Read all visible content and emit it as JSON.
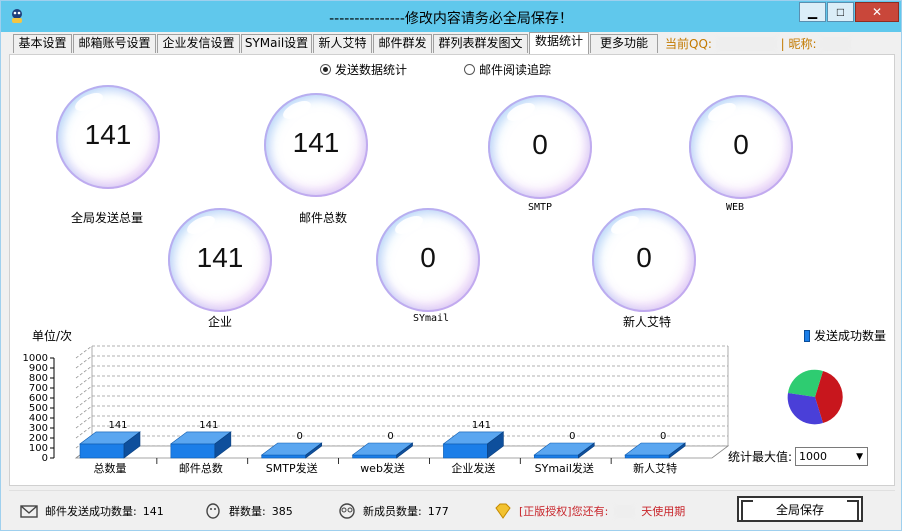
{
  "window": {
    "title": "---------------修改内容请务必全局保存！",
    "min_glyph": "▁",
    "max_glyph": "□",
    "close_glyph": "✕"
  },
  "tabs": [
    {
      "label": "基本设置"
    },
    {
      "label": "邮箱账号设置"
    },
    {
      "label": "企业发信设置"
    },
    {
      "label": "SYMail设置"
    },
    {
      "label": "新人艾特"
    },
    {
      "label": "邮件群发"
    },
    {
      "label": "群列表群发图文"
    },
    {
      "label": "数据统计",
      "active": true
    },
    {
      "label": "更多功能>>"
    }
  ],
  "account": {
    "qq_label": "当前QQ:",
    "nick_label": "| 昵称:"
  },
  "mode": {
    "option1": "发送数据统计",
    "option2": "邮件阅读追踪",
    "selected": "option1"
  },
  "bubbles": [
    {
      "value": "141",
      "label": "全局发送总量"
    },
    {
      "value": "141",
      "label": "邮件总数"
    },
    {
      "value": "0",
      "label": "SMTP"
    },
    {
      "value": "0",
      "label": "WEB"
    },
    {
      "value": "141",
      "label": "企业"
    },
    {
      "value": "0",
      "label": "SYmail"
    },
    {
      "value": "0",
      "label": "新人艾特"
    }
  ],
  "chart_data": {
    "type": "bar",
    "title": "",
    "ylabel": "单位/次",
    "xlabel": "",
    "categories": [
      "总数量",
      "邮件总数",
      "SMTP发送",
      "web发送",
      "企业发送",
      "SYmail发送",
      "新人艾特"
    ],
    "series": [
      {
        "name": "发送成功数量",
        "values": [
          141,
          141,
          0,
          0,
          141,
          0,
          0
        ],
        "color": "#1b7ee8"
      }
    ],
    "ylim": [
      0,
      1000
    ],
    "yticks": [
      0,
      100,
      200,
      300,
      400,
      500,
      600,
      700,
      800,
      900,
      1000
    ],
    "grid": true,
    "legend": "top-right",
    "style": "3d"
  },
  "pie": {
    "colors": [
      "#c8161d",
      "#2ecc71",
      "#4a3fd8"
    ]
  },
  "max_value": {
    "label": "统计最大值:",
    "selected": "1000"
  },
  "status": {
    "sent_label": "邮件发送成功数量:",
    "sent_value": "141",
    "groups_label": "群数量:",
    "groups_value": "385",
    "members_label": "新成员数量:",
    "members_value": "177",
    "license_text": "[正版授权]您还有:",
    "license_suffix": "天使用期",
    "save_label": "全局保存"
  }
}
